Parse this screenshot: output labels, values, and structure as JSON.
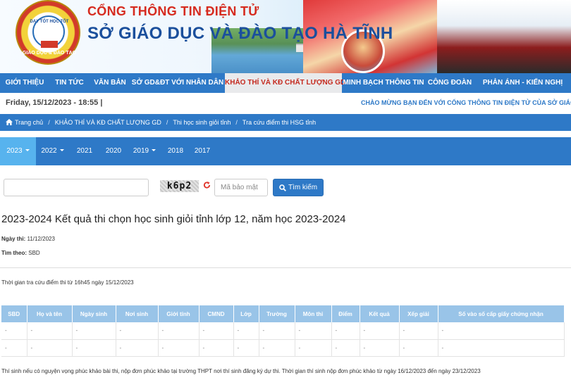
{
  "header": {
    "logo_text_top": "DẠY TỐT HỌC TỐT",
    "logo_text_bottom": "GIÁO DỤC & ĐÀO TẠO",
    "portal_name": "CỔNG THÔNG TIN ĐIỆN TỬ",
    "department_name": "SỞ GIÁO DỤC VÀ ĐÀO TẠO HÀ TĨNH"
  },
  "main_nav": {
    "items": [
      {
        "label": "GIỚI THIỆU"
      },
      {
        "label": "TIN TỨC"
      },
      {
        "label": "VĂN BẢN"
      },
      {
        "label": "SỞ GD&ĐT VỚI NHÂN DÂN"
      },
      {
        "label": "KHẢO THÍ VÀ KĐ CHẤT LƯỢNG GD"
      },
      {
        "label": "MINH BẠCH THÔNG TIN"
      },
      {
        "label": "CÔNG ĐOÀN"
      },
      {
        "label": "PHẢN ÁNH - KIẾN NGHỊ"
      }
    ],
    "active": "KHẢO THÍ VÀ KĐ CHẤT LƯỢNG GD"
  },
  "info_bar": {
    "date": "Friday, 15/12/2023 - 18:55   |",
    "marquee": "CHÀO MỪNG BẠN ĐẾN VỚI CỔNG THÔNG TIN ĐIỆN TỬ CỦA SỞ GIÁO DỤ"
  },
  "breadcrumb": {
    "items": [
      {
        "label": "Trang chủ"
      },
      {
        "label": "KHẢO THÍ VÀ KĐ CHẤT LƯỢNG GD"
      },
      {
        "label": "Thi học sinh giỏi tỉnh"
      },
      {
        "label": "Tra cứu điểm thi HSG tỉnh"
      }
    ],
    "separator": "/"
  },
  "year_tabs": {
    "items": [
      {
        "label": "2023",
        "dropdown": true
      },
      {
        "label": "2022",
        "dropdown": true
      },
      {
        "label": "2021",
        "dropdown": false
      },
      {
        "label": "2020",
        "dropdown": false
      },
      {
        "label": "2019",
        "dropdown": true
      },
      {
        "label": "2018",
        "dropdown": false
      },
      {
        "label": "2017",
        "dropdown": false
      }
    ],
    "active": "2023"
  },
  "search": {
    "query_value": "",
    "captcha_text": "k6p2",
    "captcha_placeholder": "Mã bảo mật",
    "button_label": "Tìm kiếm"
  },
  "content": {
    "title": "2023-2024 Kết quả thi chọn học sinh giỏi tỉnh lớp 12, năm học 2023-2024",
    "exam_date_label": "Ngày thi:",
    "exam_date_value": "11/12/2023",
    "search_by_label": "Tìm theo:",
    "search_by_value": "SBD",
    "lookup_time": "Thời gian tra cứu điểm thi từ 16h45 ngày 15/12/2023"
  },
  "results_table": {
    "columns": [
      "SBD",
      "Họ và tên",
      "Ngày sinh",
      "Nơi sinh",
      "Giới tính",
      "CMND",
      "Lớp",
      "Trường",
      "Môn thi",
      "Điểm",
      "Kết quả",
      "Xếp giải",
      "Số vào số cấp giấy chứng nhận"
    ],
    "rows": [
      [
        "-",
        "-",
        "-",
        "-",
        "-",
        "-",
        "-",
        "-",
        "-",
        "-",
        "-",
        "-",
        "-"
      ],
      [
        "-",
        "-",
        "-",
        "-",
        "-",
        "-",
        "-",
        "-",
        "-",
        "-",
        "-",
        "-",
        "-"
      ]
    ]
  },
  "footnote": "Thí sinh nếu có nguyện vọng phúc khảo bài thi, nộp đơn phúc khảo tại trường THPT nơi thí sinh đăng ký dự thi. Thời gian thí sinh nộp đơn phúc khảo từ ngày 16/12/2023 đến ngày 23/12/2023",
  "colors": {
    "nav_blue": "#2e79c7",
    "active_year": "#57b3ee",
    "table_header": "#99c4e8",
    "title_red": "#d62b1f",
    "title_blue": "#1b4f9c"
  },
  "icons": {
    "breadcrumb_home": "home-icon",
    "captcha_refresh": "refresh-icon",
    "search_button": "search-icon"
  }
}
